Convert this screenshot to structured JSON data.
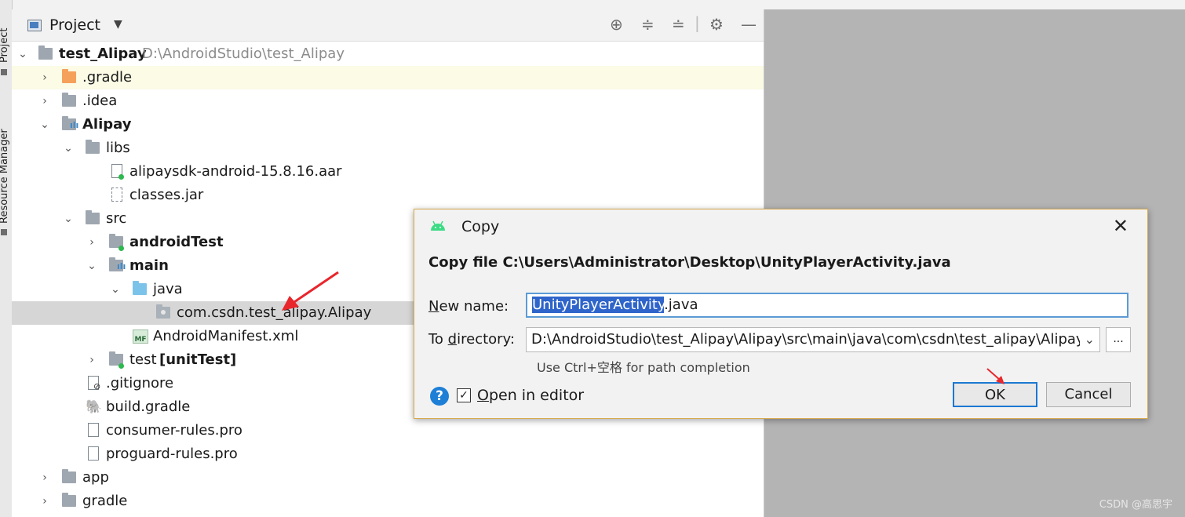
{
  "side_strip": {
    "project_tab": "Project",
    "resource_tab": "Resource Manager"
  },
  "panel": {
    "title": "Project",
    "dropdown_icon": "caret-down-icon",
    "toolbar_icons": [
      "locate-icon",
      "expand-all-icon",
      "collapse-all-icon",
      "gear-icon",
      "hide-icon"
    ]
  },
  "tree": [
    {
      "label": "test_Alipay",
      "path": "D:\\AndroidStudio\\test_Alipay"
    },
    {
      "label": ".gradle"
    },
    {
      "label": ".idea"
    },
    {
      "label": "Alipay"
    },
    {
      "label": "libs"
    },
    {
      "label": "alipaysdk-android-15.8.16.aar"
    },
    {
      "label": "classes.jar"
    },
    {
      "label": "src"
    },
    {
      "label": "androidTest"
    },
    {
      "label": "main"
    },
    {
      "label": "java"
    },
    {
      "label": "com.csdn.test_alipay.Alipay"
    },
    {
      "label": "AndroidManifest.xml",
      "badge": "MF"
    },
    {
      "label": "test",
      "suffix": "[unitTest]"
    },
    {
      "label": ".gitignore"
    },
    {
      "label": "build.gradle"
    },
    {
      "label": "consumer-rules.pro"
    },
    {
      "label": "proguard-rules.pro"
    },
    {
      "label": "app"
    },
    {
      "label": "gradle"
    }
  ],
  "dialog": {
    "title": "Copy",
    "heading": "Copy file C:\\Users\\Administrator\\Desktop\\UnityPlayerActivity.java",
    "new_name_label_u": "N",
    "new_name_label_rest": "ew name:",
    "new_name_selected": "UnityPlayerActivity",
    "new_name_ext": ".java",
    "to_dir_label_pre": "To ",
    "to_dir_label_u": "d",
    "to_dir_label_rest": "irectory:",
    "to_dir_value": "D:\\AndroidStudio\\test_Alipay\\Alipay\\src\\main\\java\\com\\csdn\\test_alipay\\Alipay",
    "browse_label": "...",
    "hint": "Use Ctrl+空格 for path completion",
    "help_label": "?",
    "open_in_editor_u": "O",
    "open_in_editor_rest": "pen in editor",
    "open_in_editor_checked": true,
    "ok_label": "OK",
    "cancel_label": "Cancel",
    "close_label": "✕"
  },
  "watermark": "CSDN @高思宇",
  "colors": {
    "selection": "#2f65ca",
    "focus_border": "#1b78d2",
    "arrow": "#e8262b"
  }
}
